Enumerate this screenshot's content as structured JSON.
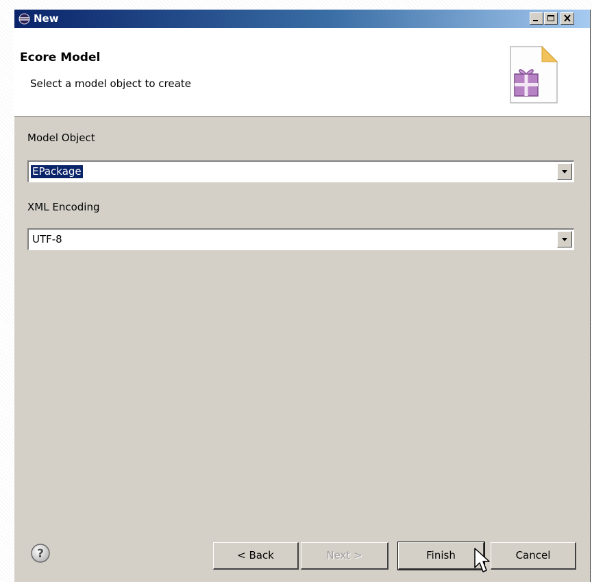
{
  "window": {
    "title": "New",
    "min_glyph": "_",
    "max_glyph": "□",
    "close_glyph": "×"
  },
  "header": {
    "title": "Ecore Model",
    "description": "Select a model object to create",
    "icon": "new-model-file-icon"
  },
  "form": {
    "model_object": {
      "label": "Model Object",
      "value": "EPackage"
    },
    "xml_encoding": {
      "label": "XML Encoding",
      "value": "UTF-8"
    }
  },
  "buttons": {
    "help_icon": "help-icon",
    "back": "< Back",
    "next": "Next >",
    "finish": "Finish",
    "cancel": "Cancel"
  },
  "colors": {
    "title_bar_start": "#0a246a",
    "title_bar_end": "#a6caf0",
    "dialog_face": "#d4d0c8",
    "selection": "#0a246a"
  }
}
